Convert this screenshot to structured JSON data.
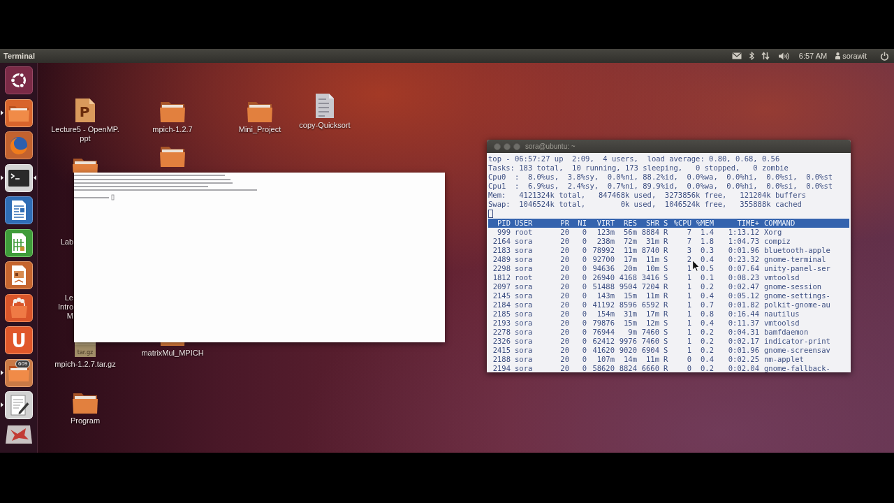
{
  "top_panel": {
    "app_title": "Terminal",
    "clock": "6:57 AM",
    "user": "sorawit"
  },
  "launcher": [
    {
      "kind": "dash",
      "running": false,
      "focused": false
    },
    {
      "kind": "files",
      "running": true,
      "focused": false
    },
    {
      "kind": "browser",
      "running": false,
      "focused": false
    },
    {
      "kind": "terminal",
      "running": true,
      "focused": true
    },
    {
      "kind": "writer",
      "running": false,
      "focused": false
    },
    {
      "kind": "calc",
      "running": false,
      "focused": false
    },
    {
      "kind": "impress",
      "running": false,
      "focused": false
    },
    {
      "kind": "software",
      "running": false,
      "focused": false
    },
    {
      "kind": "letter",
      "glyph": "U",
      "running": false,
      "focused": false
    },
    {
      "kind": "folder",
      "badge": "609",
      "running": true,
      "focused": false
    },
    {
      "kind": "editor",
      "running": true,
      "focused": false
    },
    {
      "kind": "folded",
      "running": false,
      "focused": false
    }
  ],
  "desktop": {
    "icons": [
      {
        "kind": "presentation",
        "glyph": "P",
        "label": [
          "Lecture5 - OpenMP.",
          "ppt"
        ]
      },
      {
        "kind": "folder",
        "label": [
          "mpich-1.2.7"
        ]
      },
      {
        "kind": "folder",
        "label": [
          "Mini_Project"
        ]
      },
      {
        "kind": "textfile",
        "label": [
          "copy-Quicksort"
        ]
      },
      {
        "kind": "folder"
      },
      {
        "kind": "folder"
      },
      {
        "kind": "hidden",
        "label": [
          "Lab"
        ]
      },
      {
        "kind": "hidden",
        "label": [
          "Le",
          "Intro",
          "M"
        ]
      },
      {
        "kind": "archive",
        "glyph": "tar.gz",
        "label": [
          "mpich-1.2.7.tar.gz"
        ]
      },
      {
        "kind": "folder",
        "label": [
          "matrixMul_MPICH"
        ]
      },
      {
        "kind": "folder",
        "label": [
          "Program"
        ]
      }
    ]
  },
  "terminal": {
    "title": "sora@ubuntu: ~",
    "summary": [
      "top - 06:57:27 up  2:09,  4 users,  load average: 0.80, 0.68, 0.56",
      "Tasks: 183 total,  10 running, 173 sleeping,   0 stopped,   0 zombie",
      "Cpu0  :  8.0%us,  3.8%sy,  0.0%ni, 88.2%id,  0.0%wa,  0.0%hi,  0.0%si,  0.0%st",
      "Cpu1  :  6.9%us,  2.4%sy,  0.7%ni, 89.9%id,  0.0%wa,  0.0%hi,  0.0%si,  0.0%st",
      "Mem:   4121324k total,   847468k used,  3273856k free,   121204k buffers",
      "Swap:  1046524k total,        0k used,  1046524k free,   355888k cached"
    ],
    "columns": [
      "PID",
      "USER",
      "PR",
      "NI",
      "VIRT",
      "RES",
      "SHR",
      "S",
      "%CPU",
      "%MEM",
      "TIME+",
      "COMMAND"
    ],
    "rows": [
      [
        "999",
        "root",
        "20",
        "0",
        "123m",
        "56m",
        "8884",
        "R",
        "7",
        "1.4",
        "1:13.12",
        "Xorg"
      ],
      [
        "2164",
        "sora",
        "20",
        "0",
        "238m",
        "72m",
        "31m",
        "R",
        "7",
        "1.8",
        "1:04.73",
        "compiz"
      ],
      [
        "2183",
        "sora",
        "20",
        "0",
        "78992",
        "11m",
        "8740",
        "R",
        "3",
        "0.3",
        "0:01.96",
        "bluetooth-apple"
      ],
      [
        "2489",
        "sora",
        "20",
        "0",
        "92700",
        "17m",
        "11m",
        "S",
        "2",
        "0.4",
        "0:23.32",
        "gnome-terminal"
      ],
      [
        "2298",
        "sora",
        "20",
        "0",
        "94636",
        "20m",
        "10m",
        "S",
        "1",
        "0.5",
        "0:07.64",
        "unity-panel-ser"
      ],
      [
        "1812",
        "root",
        "20",
        "0",
        "26940",
        "4168",
        "3416",
        "S",
        "1",
        "0.1",
        "0:08.23",
        "vmtoolsd"
      ],
      [
        "2097",
        "sora",
        "20",
        "0",
        "51488",
        "9504",
        "7204",
        "R",
        "1",
        "0.2",
        "0:02.47",
        "gnome-session"
      ],
      [
        "2145",
        "sora",
        "20",
        "0",
        "143m",
        "15m",
        "11m",
        "R",
        "1",
        "0.4",
        "0:05.12",
        "gnome-settings-"
      ],
      [
        "2184",
        "sora",
        "20",
        "0",
        "41192",
        "8596",
        "6592",
        "R",
        "1",
        "0.7",
        "0:01.82",
        "polkit-gnome-au"
      ],
      [
        "2185",
        "sora",
        "20",
        "0",
        "154m",
        "31m",
        "17m",
        "R",
        "1",
        "0.8",
        "0:16.44",
        "nautilus"
      ],
      [
        "2193",
        "sora",
        "20",
        "0",
        "79876",
        "15m",
        "12m",
        "S",
        "1",
        "0.4",
        "0:11.37",
        "vmtoolsd"
      ],
      [
        "2278",
        "sora",
        "20",
        "0",
        "76944",
        "9m",
        "7460",
        "S",
        "1",
        "0.2",
        "0:04.31",
        "bamfdaemon"
      ],
      [
        "2326",
        "sora",
        "20",
        "0",
        "62412",
        "9976",
        "7460",
        "S",
        "1",
        "0.2",
        "0:02.17",
        "indicator-print"
      ],
      [
        "2415",
        "sora",
        "20",
        "0",
        "41620",
        "9020",
        "6904",
        "S",
        "1",
        "0.2",
        "0:01.96",
        "gnome-screensav"
      ],
      [
        "2188",
        "sora",
        "20",
        "0",
        "107m",
        "14m",
        "11m",
        "R",
        "0",
        "0.4",
        "0:02.25",
        "nm-applet"
      ],
      [
        "2194",
        "sora",
        "20",
        "0",
        "58620",
        "8824",
        "6660",
        "R",
        "0",
        "0.2",
        "0:02.04",
        "gnome-fallback-"
      ]
    ]
  }
}
